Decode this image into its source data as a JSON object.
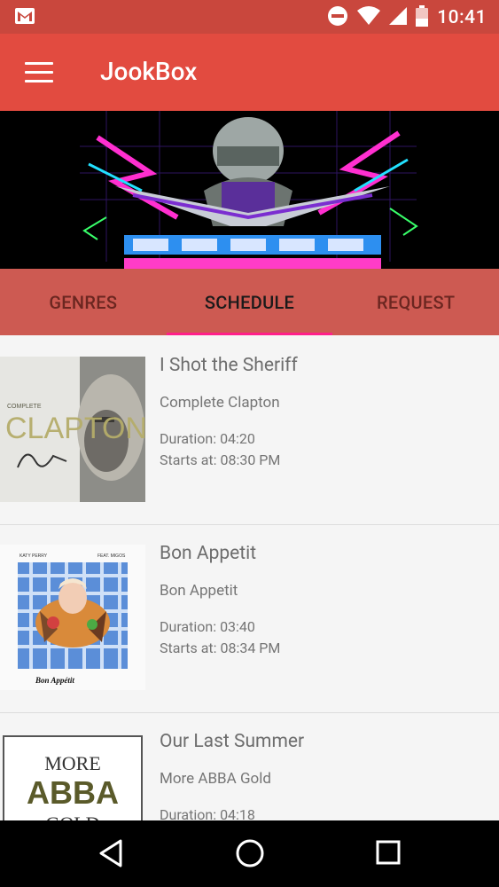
{
  "status_bar": {
    "time": "10:41"
  },
  "app_bar": {
    "title": "JookBox"
  },
  "tabs": [
    {
      "label": "GENRES"
    },
    {
      "label": "SCHEDULE"
    },
    {
      "label": "REQUEST"
    }
  ],
  "active_tab": "SCHEDULE",
  "schedule": [
    {
      "song": "I Shot the Sheriff",
      "album": "Complete Clapton",
      "duration": "Duration: 04:20",
      "starts": "Starts at: 08:30 PM"
    },
    {
      "song": "Bon Appetit",
      "album": "Bon Appetit",
      "duration": "Duration: 03:40",
      "starts": "Starts at: 08:34 PM"
    },
    {
      "song": "Our Last Summer",
      "album": "More ABBA Gold",
      "duration": "Duration: 04:18",
      "starts": ""
    }
  ],
  "colors": {
    "status_bar": "#c9473d",
    "app_bar": "#e24b40",
    "tab_bar": "#cd5a52",
    "tab_indicator": "#ff1f8a"
  }
}
